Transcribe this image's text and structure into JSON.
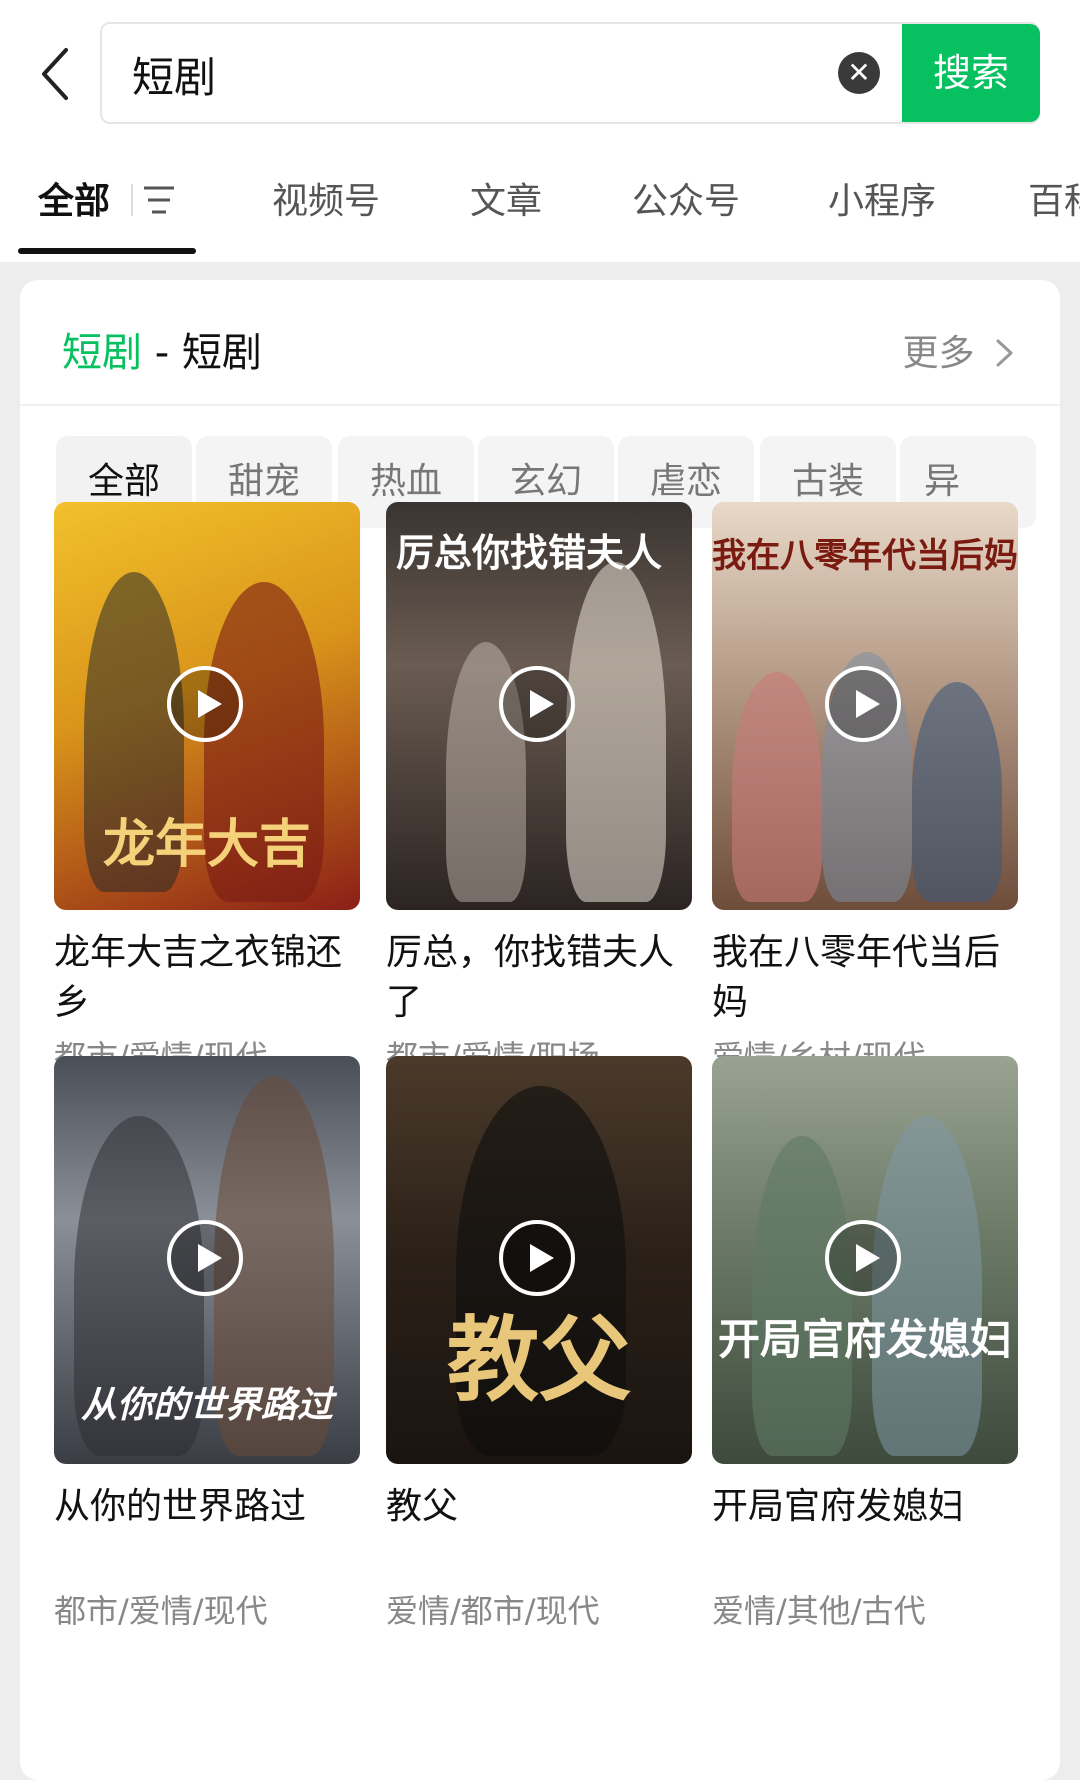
{
  "search": {
    "value": "短剧",
    "button_label": "搜索"
  },
  "tabs": [
    {
      "label": "全部"
    },
    {
      "label": "视频号"
    },
    {
      "label": "文章"
    },
    {
      "label": "公众号"
    },
    {
      "label": "小程序"
    },
    {
      "label": "百科"
    }
  ],
  "section": {
    "keyword": "短剧",
    "separator": " - ",
    "category": "短剧",
    "more_label": "更多"
  },
  "chips": [
    {
      "label": "全部"
    },
    {
      "label": "甜宠"
    },
    {
      "label": "热血"
    },
    {
      "label": "玄幻"
    },
    {
      "label": "虐恋"
    },
    {
      "label": "古装"
    },
    {
      "label": "异"
    }
  ],
  "items": [
    {
      "title": "龙年大吉之衣锦还乡",
      "tags": "都市/爱情/现代",
      "poster_text": "龙年大吉"
    },
    {
      "title": "厉总，你找错夫人了",
      "tags": "都市/爱情/职场",
      "poster_text": "厉总你找错夫人"
    },
    {
      "title": "我在八零年代当后妈",
      "tags": "爱情/乡村/现代",
      "poster_text": "我在八零年代当后妈"
    },
    {
      "title": "从你的世界路过",
      "tags": "都市/爱情/现代",
      "poster_text": "从你的世界路过"
    },
    {
      "title": "教父",
      "tags": "爱情/都市/现代",
      "poster_text": "教父"
    },
    {
      "title": "开局官府发媳妇",
      "tags": "爱情/其他/古代",
      "poster_text": "开局官府发媳妇"
    }
  ],
  "colors": {
    "accent": "#07c160"
  }
}
